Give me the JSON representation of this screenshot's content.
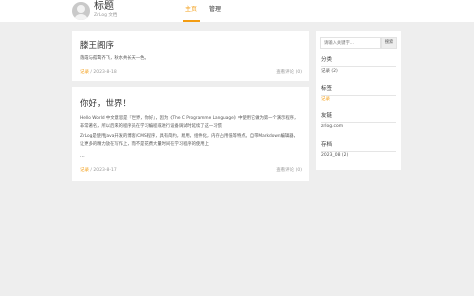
{
  "header": {
    "title": "标题",
    "subtitle": "ZrLog 文档",
    "nav": {
      "home": "主页",
      "admin": "管理"
    }
  },
  "posts": [
    {
      "title": "滕王阁序",
      "excerpt": "落霞与孤鹜齐飞，秋水共长天一色。",
      "category": "记录",
      "date": "2023-8-18",
      "comments": "查看评论 (0)"
    },
    {
      "title": "你好，世界！",
      "excerpt_1": "Hello World 中文意思是『世界，你好』，因为《The C Programme Language》中使用它做为第一个演示程序，非常著名，所以后来的程序员在学习编程或进行设备调试时延续了这一习惯",
      "excerpt_2": "ZrLog是使用Java开发的博客/CMS程序，具有简约，易用，组件化，内存占用低等特点。自带Markdown编辑器，让更多的精力放在写作上，而不是花费大量时间在学习程序的使用上",
      "ellipsis": "...",
      "category": "记录",
      "date": "2023-8-17",
      "comments": "查看评论 (0)"
    }
  ],
  "sidebar": {
    "search": {
      "placeholder": "请输入关键字...",
      "button": "搜索"
    },
    "sections": [
      {
        "heading": "分类",
        "item": "记录 (2)"
      },
      {
        "heading": "标签",
        "item": "记录"
      },
      {
        "heading": "友链",
        "item": "zrlog.com"
      },
      {
        "heading": "存档",
        "item": "2023_08 (2)"
      }
    ]
  },
  "colors": {
    "accent": "#f39c12",
    "background": "#eeeeee",
    "card": "#ffffff"
  }
}
